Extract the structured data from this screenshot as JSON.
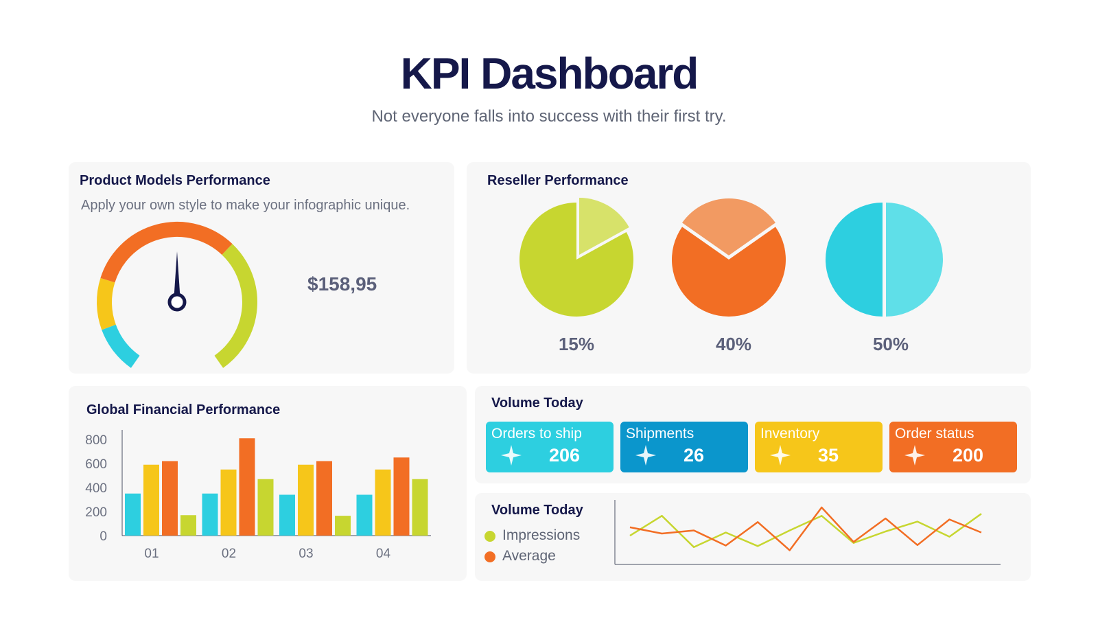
{
  "header": {
    "title": "KPI Dashboard",
    "subtitle": "Not everyone falls into success with their first try."
  },
  "product": {
    "title": "Product Models Performance",
    "subtitle": "Apply your own style to make your infographic unique.",
    "gauge_value": "$158,95"
  },
  "reseller": {
    "title": "Reseller Performance",
    "labels": [
      "15%",
      "40%",
      "50%"
    ]
  },
  "financial": {
    "title": "Global Financial Performance"
  },
  "volume": {
    "title": "Volume Today",
    "tiles": [
      {
        "label": "Orders to ship",
        "value": "206",
        "color": "#2dcfe0"
      },
      {
        "label": "Shipments",
        "value": "26",
        "color": "#0b96cc"
      },
      {
        "label": "Inventory",
        "value": "35",
        "color": "#f6c61a"
      },
      {
        "label": "Order status",
        "value": "200",
        "color": "#f26e24"
      }
    ]
  },
  "volume_line": {
    "title": "Volume Today",
    "legend": [
      {
        "label": "Impressions",
        "color": "#c7d630"
      },
      {
        "label": "Average",
        "color": "#f26e24"
      }
    ]
  },
  "colors": {
    "cyan": "#2dcfe0",
    "yellow": "#f6c61a",
    "orange": "#f26e24",
    "lime": "#c7d630",
    "navy": "#15184a"
  },
  "chart_data": [
    {
      "type": "gauge",
      "segments": [
        {
          "color": "#2dcfe0",
          "fraction": 0.12
        },
        {
          "color": "#f6c61a",
          "fraction": 0.13
        },
        {
          "color": "#f26e24",
          "fraction": 0.4
        },
        {
          "color": "#c7d630",
          "fraction": 0.35
        }
      ],
      "value_label": "$158,95",
      "needle_fraction": 0.5
    },
    {
      "type": "pie",
      "slices": [
        {
          "label": "15%",
          "value": 15,
          "color": "#c7d630",
          "accent": "#d7e26a"
        },
        {
          "label": "40%",
          "value": 40,
          "color": "#f26e24",
          "accent": "#f29a62"
        },
        {
          "label": "50%",
          "value": 50,
          "color": "#2dcfe0",
          "accent": "#5fdfe8"
        }
      ]
    },
    {
      "type": "bar",
      "categories": [
        "01",
        "02",
        "03",
        "04"
      ],
      "ylim": [
        0,
        800
      ],
      "yticks": [
        0,
        200,
        400,
        600,
        800
      ],
      "series": [
        {
          "color": "#2dcfe0",
          "values": [
            350,
            350,
            340,
            340
          ]
        },
        {
          "color": "#f6c61a",
          "values": [
            590,
            550,
            590,
            550
          ]
        },
        {
          "color": "#f26e24",
          "values": [
            620,
            810,
            620,
            650
          ]
        },
        {
          "color": "#c7d630",
          "values": [
            170,
            470,
            165,
            470
          ]
        }
      ]
    },
    {
      "type": "line",
      "ylim": [
        0,
        100
      ],
      "series": [
        {
          "name": "Impressions",
          "color": "#c7d630",
          "values": [
            42,
            80,
            20,
            48,
            22,
            52,
            80,
            28,
            50,
            69,
            40,
            84
          ]
        },
        {
          "name": "Average",
          "color": "#f26e24",
          "values": [
            58,
            46,
            52,
            23,
            68,
            14,
            96,
            30,
            75,
            24,
            73,
            48
          ]
        }
      ]
    }
  ]
}
